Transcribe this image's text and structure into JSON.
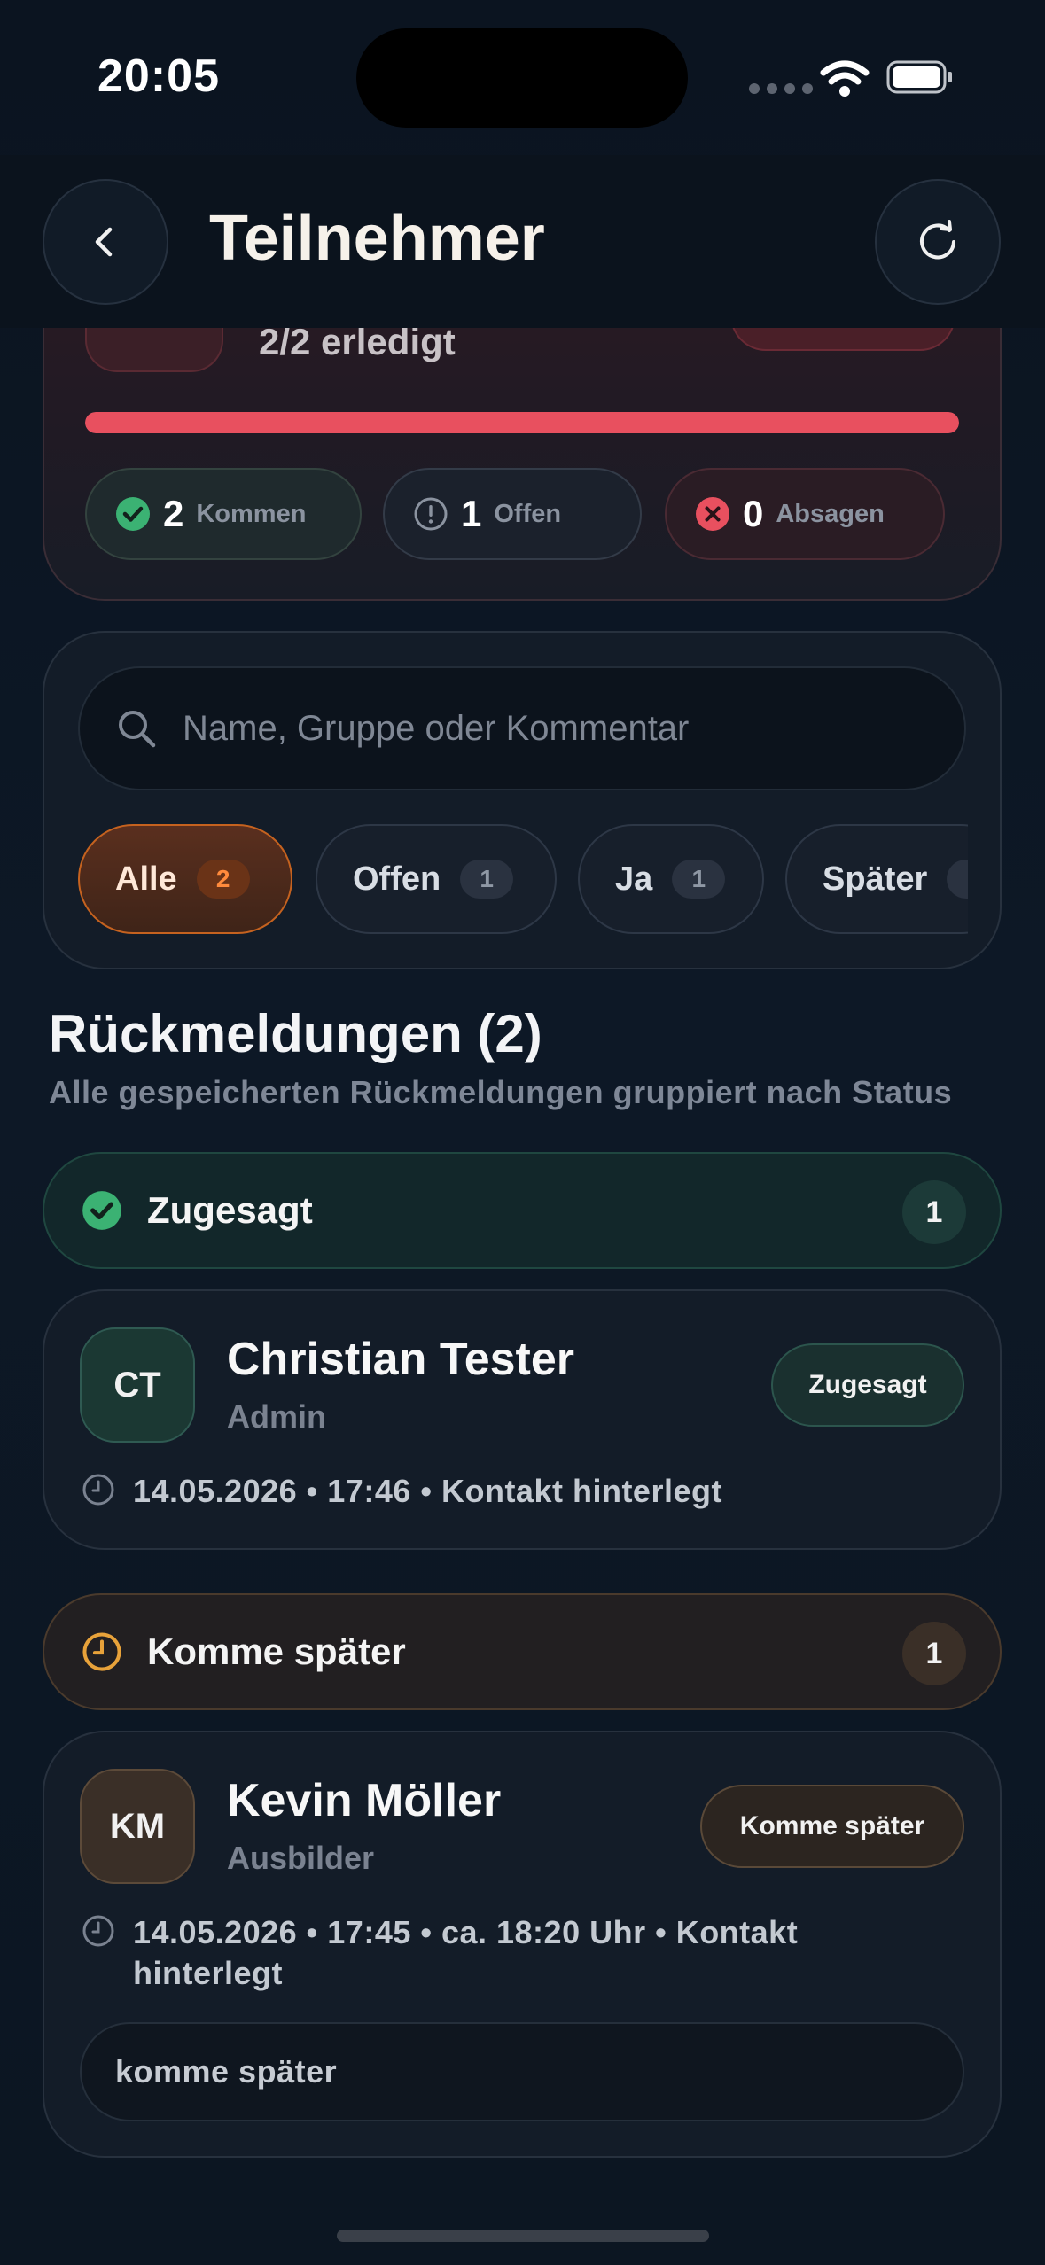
{
  "status_bar": {
    "time": "20:05"
  },
  "header": {
    "title": "Teilnehmer",
    "back_icon": "chevron-left-icon",
    "refresh_icon": "refresh-icon"
  },
  "summary": {
    "done_text": "2/2 erledigt",
    "progress": 1.0,
    "progress_color": "#e8505f",
    "stats": [
      {
        "count": "2",
        "label": "Kommen",
        "icon": "check-circle-icon",
        "color": "#3bb273"
      },
      {
        "count": "1",
        "label": "Offen",
        "icon": "alert-circle-icon",
        "color": "#8b93a0"
      },
      {
        "count": "0",
        "label": "Absagen",
        "icon": "x-circle-icon",
        "color": "#e8505f"
      }
    ]
  },
  "search": {
    "placeholder": "Name, Gruppe oder Kommentar",
    "icon": "search-icon"
  },
  "filters": [
    {
      "label": "Alle",
      "count": "2",
      "active": true
    },
    {
      "label": "Offen",
      "count": "1",
      "active": false
    },
    {
      "label": "Ja",
      "count": "1",
      "active": false
    },
    {
      "label": "Später",
      "count": "",
      "active": false
    }
  ],
  "responses": {
    "title": "Rückmeldungen (2)",
    "subtitle": "Alle gespeicherten Rückmeldungen gruppiert nach Status"
  },
  "groups": [
    {
      "label": "Zugesagt",
      "count": "1",
      "icon": "check-circle-icon",
      "accent": "#3bb273",
      "person": {
        "initials": "CT",
        "name": "Christian Tester",
        "role": "Admin",
        "status": "Zugesagt",
        "meta": "14.05.2026 • 17:46 • Kontakt hinterlegt"
      }
    },
    {
      "label": "Komme später",
      "count": "1",
      "icon": "clock-icon",
      "accent": "#e8a23a",
      "person": {
        "initials": "KM",
        "name": "Kevin Möller",
        "role": "Ausbilder",
        "status": "Komme später",
        "meta": "14.05.2026 • 17:45 • ca. 18:20 Uhr • Kontakt hinterlegt",
        "comment": "komme später"
      }
    }
  ]
}
